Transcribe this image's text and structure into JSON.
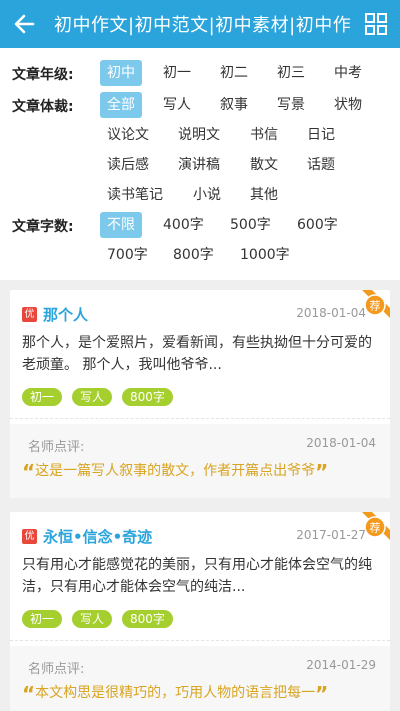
{
  "header": {
    "title": "初中作文|初中范文|初中素材|初中作文大全",
    "back_icon": "arrow-left-icon",
    "menu_icon": "grid-icon"
  },
  "filters": {
    "grade": {
      "label": "文章年级:",
      "options": [
        "初中",
        "初一",
        "初二",
        "初三",
        "中考"
      ],
      "active": "初中"
    },
    "genre": {
      "label": "文章体裁:",
      "options": [
        "全部",
        "写人",
        "叙事",
        "写景",
        "状物",
        "议论文",
        "说明文",
        "书信",
        "日记",
        "读后感",
        "演讲稿",
        "散文",
        "话题",
        "读书笔记",
        "小说",
        "其他"
      ],
      "active": "全部"
    },
    "wordcount": {
      "label": "文章字数:",
      "options": [
        "不限",
        "400字",
        "500字",
        "600字",
        "700字",
        "800字",
        "1000字"
      ],
      "active": "不限"
    }
  },
  "articles": [
    {
      "badge": "优",
      "title": "那个人",
      "date": "2018-01-04",
      "ribbon": "荐",
      "excerpt": "那个人，是个爱照片，爱看新闻，有些执拗但十分可爱的老顽童。 那个人，我叫他爷爷...",
      "tags": [
        "初一",
        "写人",
        "800字"
      ],
      "review_label": "名师点评:",
      "review_date": "2018-01-04",
      "review_text": "这是一篇写人叙事的散文，作者开篇点出爷爷"
    },
    {
      "badge": "优",
      "title": "永恒•信念•奇迹",
      "date": "2017-01-27",
      "ribbon": "荐",
      "excerpt": "只有用心才能感觉花的美丽，只有用心才能体会空气的纯洁，只有用心才能体会空气的纯洁...",
      "tags": [
        "初一",
        "写人",
        "800字"
      ],
      "review_label": "名师点评:",
      "review_date": "2014-01-29",
      "review_text": "本文构思是很精巧的，巧用人物的语言把每一"
    }
  ],
  "colors": {
    "primary": "#2ba4dc",
    "active_option": "#7cc9ec",
    "tag": "#a5cf2e",
    "badge": "#e8483c",
    "ribbon": "#f39a1e",
    "quote": "#d9a421"
  }
}
